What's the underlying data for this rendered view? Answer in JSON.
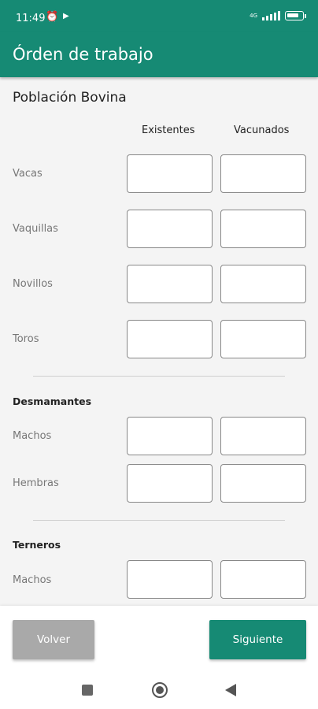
{
  "status_bar": {
    "time": "11:49",
    "alarm_icon": "alarm-icon",
    "play_icon": "play-icon",
    "network": "4G",
    "battery_icon": "battery-icon"
  },
  "app_bar": {
    "title": "Órden de trabajo"
  },
  "form": {
    "section_title": "Población Bovina",
    "columns": {
      "existentes": "Existentes",
      "vacunados": "Vacunados"
    },
    "rows": {
      "vacas": "Vacas",
      "vaquillas": "Vaquillas",
      "novillos": "Novillos",
      "toros": "Toros"
    },
    "desmamantes": {
      "title": "Desmamantes",
      "machos": "Machos",
      "hembras": "Hembras"
    },
    "terneros": {
      "title": "Terneros",
      "machos": "Machos"
    }
  },
  "buttons": {
    "volver": "Volver",
    "siguiente": "Siguiente"
  },
  "colors": {
    "primary": "#168a74",
    "disabled": "#a9a9a9"
  }
}
